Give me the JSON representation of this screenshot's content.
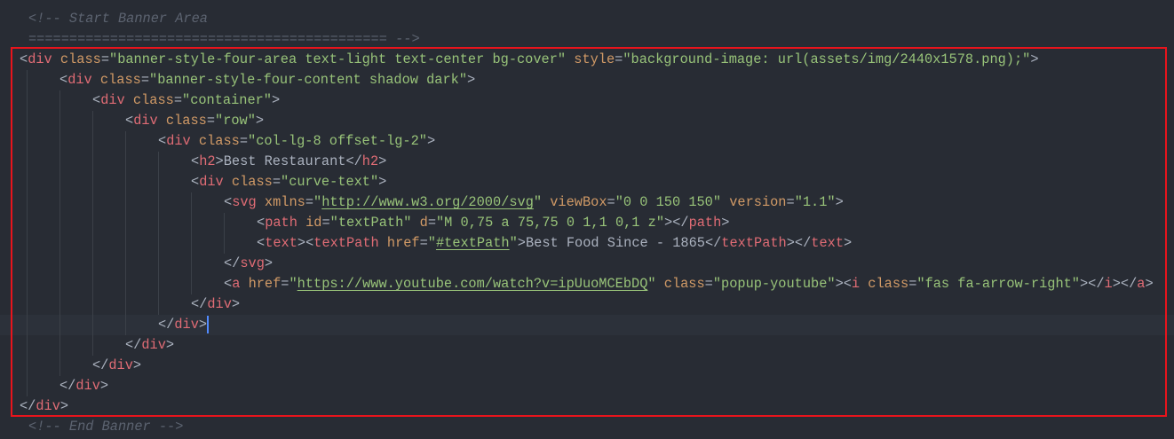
{
  "editor": {
    "colors": {
      "background": "#282c34",
      "tag": "#e06c75",
      "attr": "#d19a66",
      "string": "#98c379",
      "comment": "#5c6370",
      "highlight_box": "#e8141c"
    },
    "lines": [
      {
        "indent": 0,
        "comment": true,
        "tokens": [
          [
            "comment",
            "<!-- Start Banner Area"
          ]
        ]
      },
      {
        "indent": 0,
        "comment": true,
        "tokens": [
          [
            "comment",
            "============================================ -->"
          ]
        ]
      },
      {
        "indent": 0,
        "tokens": [
          [
            "punc",
            "<"
          ],
          [
            "tag",
            "div"
          ],
          [
            "punc",
            " "
          ],
          [
            "attr",
            "class"
          ],
          [
            "punc",
            "="
          ],
          [
            "str",
            "\"banner-style-four-area text-light text-center bg-cover\""
          ],
          [
            "punc",
            " "
          ],
          [
            "attr",
            "style"
          ],
          [
            "punc",
            "="
          ],
          [
            "str",
            "\"background-image: url(assets/img/2440x1578.png);\""
          ],
          [
            "punc",
            ">"
          ]
        ]
      },
      {
        "indent": 1,
        "tokens": [
          [
            "punc",
            "<"
          ],
          [
            "tag",
            "div"
          ],
          [
            "punc",
            " "
          ],
          [
            "attr",
            "class"
          ],
          [
            "punc",
            "="
          ],
          [
            "str",
            "\"banner-style-four-content shadow dark\""
          ],
          [
            "punc",
            ">"
          ]
        ]
      },
      {
        "indent": 2,
        "tokens": [
          [
            "punc",
            "<"
          ],
          [
            "tag",
            "div"
          ],
          [
            "punc",
            " "
          ],
          [
            "attr",
            "class"
          ],
          [
            "punc",
            "="
          ],
          [
            "str",
            "\"container\""
          ],
          [
            "punc",
            ">"
          ]
        ]
      },
      {
        "indent": 3,
        "tokens": [
          [
            "punc",
            "<"
          ],
          [
            "tag",
            "div"
          ],
          [
            "punc",
            " "
          ],
          [
            "attr",
            "class"
          ],
          [
            "punc",
            "="
          ],
          [
            "str",
            "\"row\""
          ],
          [
            "punc",
            ">"
          ]
        ]
      },
      {
        "indent": 4,
        "tokens": [
          [
            "punc",
            "<"
          ],
          [
            "tag",
            "div"
          ],
          [
            "punc",
            " "
          ],
          [
            "attr",
            "class"
          ],
          [
            "punc",
            "="
          ],
          [
            "str",
            "\"col-lg-8 offset-lg-2\""
          ],
          [
            "punc",
            ">"
          ]
        ]
      },
      {
        "indent": 5,
        "tokens": [
          [
            "punc",
            "<"
          ],
          [
            "tag",
            "h2"
          ],
          [
            "punc",
            ">"
          ],
          [
            "text",
            "Best Restaurant"
          ],
          [
            "punc",
            "</"
          ],
          [
            "tag",
            "h2"
          ],
          [
            "punc",
            ">"
          ]
        ]
      },
      {
        "indent": 5,
        "tokens": [
          [
            "punc",
            "<"
          ],
          [
            "tag",
            "div"
          ],
          [
            "punc",
            " "
          ],
          [
            "attr",
            "class"
          ],
          [
            "punc",
            "="
          ],
          [
            "str",
            "\"curve-text\""
          ],
          [
            "punc",
            ">"
          ]
        ]
      },
      {
        "indent": 6,
        "tokens": [
          [
            "punc",
            "<"
          ],
          [
            "tag",
            "svg"
          ],
          [
            "punc",
            " "
          ],
          [
            "attr",
            "xmlns"
          ],
          [
            "punc",
            "="
          ],
          [
            "str",
            "\""
          ],
          [
            "url",
            "http://www.w3.org/2000/svg"
          ],
          [
            "str",
            "\""
          ],
          [
            "punc",
            " "
          ],
          [
            "attr",
            "viewBox"
          ],
          [
            "punc",
            "="
          ],
          [
            "str",
            "\"0 0 150 150\""
          ],
          [
            "punc",
            " "
          ],
          [
            "attr",
            "version"
          ],
          [
            "punc",
            "="
          ],
          [
            "str",
            "\"1.1\""
          ],
          [
            "punc",
            ">"
          ]
        ]
      },
      {
        "indent": 7,
        "tokens": [
          [
            "punc",
            "<"
          ],
          [
            "tag",
            "path"
          ],
          [
            "punc",
            " "
          ],
          [
            "attr",
            "id"
          ],
          [
            "punc",
            "="
          ],
          [
            "str",
            "\"textPath\""
          ],
          [
            "punc",
            " "
          ],
          [
            "attr",
            "d"
          ],
          [
            "punc",
            "="
          ],
          [
            "str",
            "\"M 0,75 a 75,75 0 1,1 0,1 z\""
          ],
          [
            "punc",
            "></"
          ],
          [
            "tag",
            "path"
          ],
          [
            "punc",
            ">"
          ]
        ]
      },
      {
        "indent": 7,
        "tokens": [
          [
            "punc",
            "<"
          ],
          [
            "tag",
            "text"
          ],
          [
            "punc",
            "><"
          ],
          [
            "tag",
            "textPath"
          ],
          [
            "punc",
            " "
          ],
          [
            "attr",
            "href"
          ],
          [
            "punc",
            "="
          ],
          [
            "str",
            "\""
          ],
          [
            "url",
            "#textPath"
          ],
          [
            "str",
            "\""
          ],
          [
            "punc",
            ">"
          ],
          [
            "text",
            "Best Food Since - 1865"
          ],
          [
            "punc",
            "</"
          ],
          [
            "tag",
            "textPath"
          ],
          [
            "punc",
            "></"
          ],
          [
            "tag",
            "text"
          ],
          [
            "punc",
            ">"
          ]
        ]
      },
      {
        "indent": 6,
        "tokens": [
          [
            "punc",
            "</"
          ],
          [
            "tag",
            "svg"
          ],
          [
            "punc",
            ">"
          ]
        ]
      },
      {
        "indent": 6,
        "tokens": [
          [
            "punc",
            "<"
          ],
          [
            "tag",
            "a"
          ],
          [
            "punc",
            " "
          ],
          [
            "attr",
            "href"
          ],
          [
            "punc",
            "="
          ],
          [
            "str",
            "\""
          ],
          [
            "url",
            "https://www.youtube.com/watch?v=ipUuoMCEbDQ"
          ],
          [
            "str",
            "\""
          ],
          [
            "punc",
            " "
          ],
          [
            "attr",
            "class"
          ],
          [
            "punc",
            "="
          ],
          [
            "str",
            "\"popup-youtube\""
          ],
          [
            "punc",
            "><"
          ],
          [
            "tag",
            "i"
          ],
          [
            "punc",
            " "
          ],
          [
            "attr",
            "class"
          ],
          [
            "punc",
            "="
          ],
          [
            "str",
            "\"fas fa-arrow-right\""
          ],
          [
            "punc",
            "></"
          ],
          [
            "tag",
            "i"
          ],
          [
            "punc",
            "></"
          ],
          [
            "tag",
            "a"
          ],
          [
            "punc",
            ">"
          ]
        ]
      },
      {
        "indent": 5,
        "tokens": [
          [
            "punc",
            "</"
          ],
          [
            "tag",
            "div"
          ],
          [
            "punc",
            ">"
          ]
        ]
      },
      {
        "indent": 4,
        "current": true,
        "tokens": [
          [
            "punc",
            "</"
          ],
          [
            "tag",
            "div"
          ],
          [
            "punc",
            ">"
          ]
        ]
      },
      {
        "indent": 3,
        "tokens": [
          [
            "punc",
            "</"
          ],
          [
            "tag",
            "div"
          ],
          [
            "punc",
            ">"
          ]
        ]
      },
      {
        "indent": 2,
        "tokens": [
          [
            "punc",
            "</"
          ],
          [
            "tag",
            "div"
          ],
          [
            "punc",
            ">"
          ]
        ]
      },
      {
        "indent": 1,
        "tokens": [
          [
            "punc",
            "</"
          ],
          [
            "tag",
            "div"
          ],
          [
            "punc",
            ">"
          ]
        ]
      },
      {
        "indent": 0,
        "tokens": [
          [
            "punc",
            "</"
          ],
          [
            "tag",
            "div"
          ],
          [
            "punc",
            ">"
          ]
        ]
      },
      {
        "indent": 0,
        "comment": true,
        "tokens": [
          [
            "comment",
            "<!-- End Banner -->"
          ]
        ]
      }
    ]
  }
}
